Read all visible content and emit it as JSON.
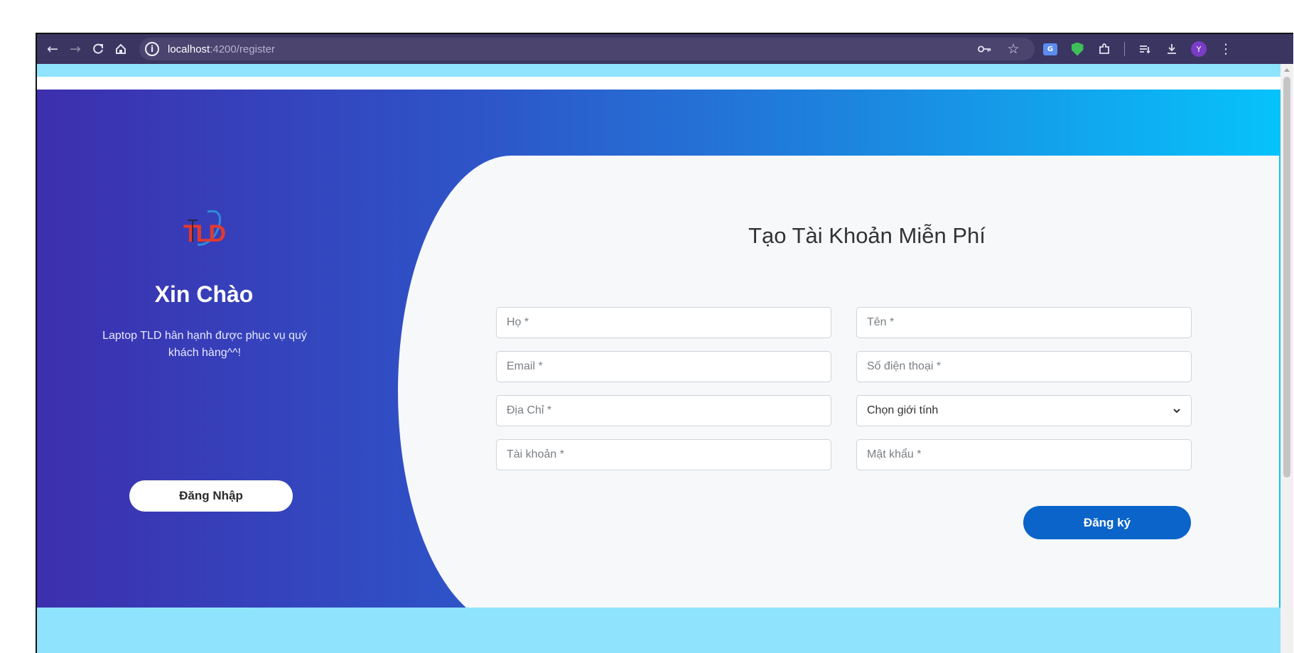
{
  "browser": {
    "url_host": "localhost",
    "url_path": ":4200/register",
    "profile_initial": "Y",
    "translate_badge": "G"
  },
  "welcome": {
    "logo_text": "TLD",
    "title": "Xin Chào",
    "message": "Laptop TLD hân hạnh được phục vụ quý khách hàng^^!",
    "login_button": "Đăng Nhập"
  },
  "form": {
    "title": "Tạo Tài Khoản Miễn Phí",
    "last_name_placeholder": "Họ *",
    "first_name_placeholder": "Tên *",
    "email_placeholder": "Email *",
    "phone_placeholder": "Số điện thoại *",
    "address_placeholder": "Địa Chỉ *",
    "gender_select": "Chọn giới tính",
    "username_placeholder": "Tài khoản *",
    "password_placeholder": "Mật khẩu *",
    "register_button": "Đăng ký"
  },
  "colors": {
    "gradient_start": "#3d2fae",
    "gradient_end": "#06c3fb",
    "register_button": "#0a64c9",
    "browser_toolbar": "#3b3561"
  }
}
